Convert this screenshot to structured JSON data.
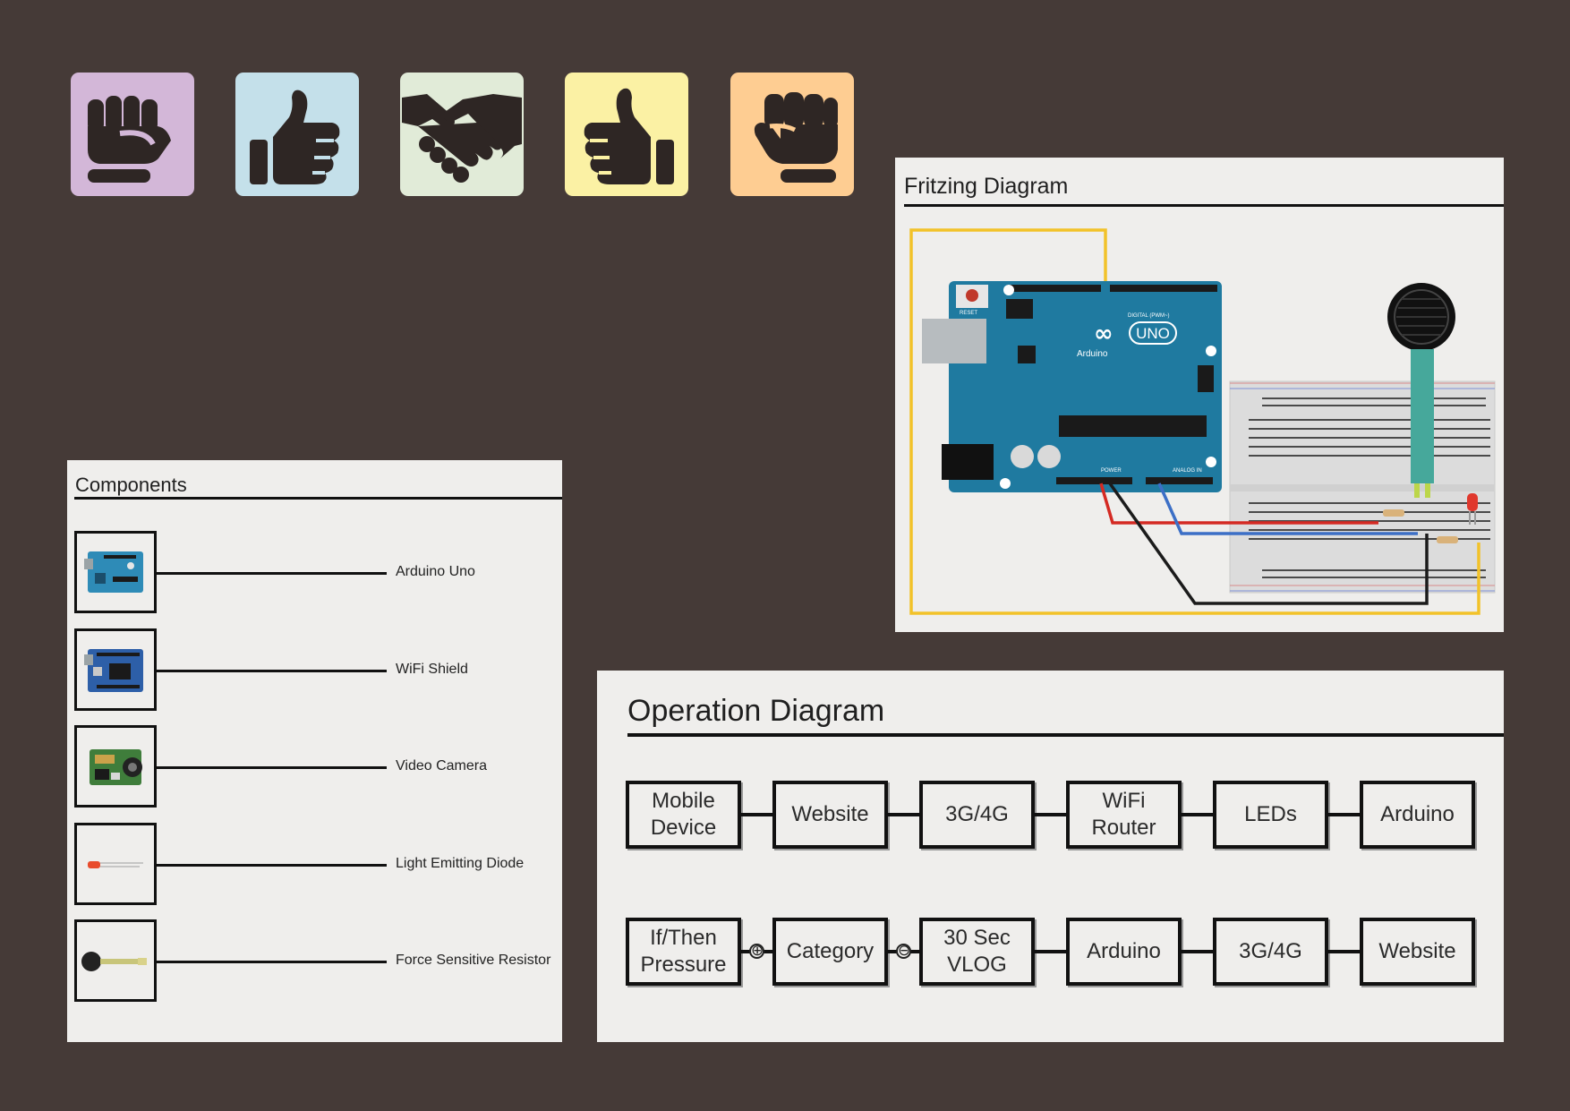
{
  "icons": [
    {
      "name": "fist-icon",
      "color": "#d3b7d8"
    },
    {
      "name": "thumbs-up-icon",
      "color": "#c4e0ea"
    },
    {
      "name": "handshake-icon",
      "color": "#e1ebd8"
    },
    {
      "name": "thumbs-up-icon",
      "color": "#fbf1a4"
    },
    {
      "name": "raised-fist-icon",
      "color": "#fecd92"
    }
  ],
  "components": {
    "title": "Components",
    "items": [
      {
        "label": "Arduino Uno",
        "thumb": "arduino-uno-icon"
      },
      {
        "label": "WiFi Shield",
        "thumb": "wifi-shield-icon"
      },
      {
        "label": "Video Camera",
        "thumb": "video-camera-icon"
      },
      {
        "label": "Light Emitting Diode",
        "thumb": "led-icon"
      },
      {
        "label": "Force Sensitive Resistor",
        "thumb": "force-sensor-icon"
      }
    ]
  },
  "fritzing": {
    "title": "Fritzing Diagram",
    "board": {
      "logo": "UNO",
      "brand": "Arduino",
      "reset": "RESET",
      "digital": "DIGITAL (PWM~)",
      "power": "POWER",
      "analog": "ANALOG IN"
    },
    "wire_colors": {
      "yellow": "#f2c229",
      "red": "#d42a23",
      "blue": "#3c6fc6",
      "black": "#1b1b1b"
    }
  },
  "operation": {
    "title": "Operation Diagram",
    "row1": [
      "Mobile\nDevice",
      "Website",
      "3G/4G",
      "WiFi\nRouter",
      "LEDs",
      "Arduino"
    ],
    "row2": [
      "If/Then\nPressure",
      "Category",
      "30 Sec\nVLOG",
      "Arduino",
      "3G/4G",
      "Website"
    ],
    "symbols": [
      "⊕",
      "⊖"
    ]
  }
}
